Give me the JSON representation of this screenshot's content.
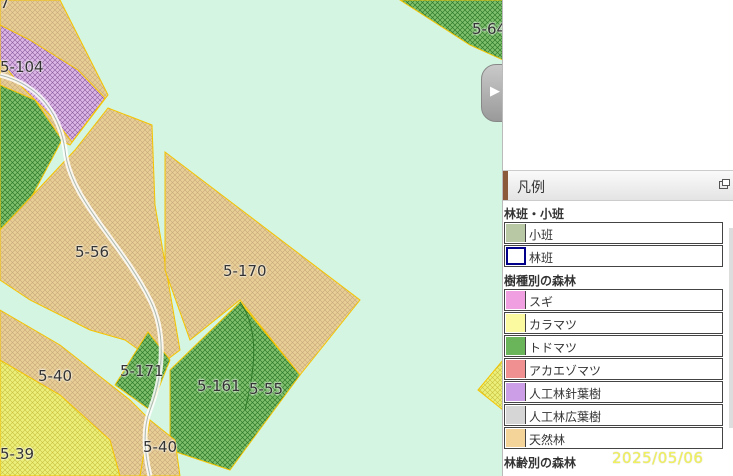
{
  "map": {
    "labels": [
      {
        "name": "stand-5-104",
        "text": "5-104"
      },
      {
        "name": "stand-5-56",
        "text": "5-56"
      },
      {
        "name": "stand-5-170",
        "text": "5-170"
      },
      {
        "name": "stand-5-40-top",
        "text": "5-40"
      },
      {
        "name": "stand-5-171",
        "text": "5-171"
      },
      {
        "name": "stand-5-161",
        "text": "5-161"
      },
      {
        "name": "stand-5-55",
        "text": "5-55"
      },
      {
        "name": "stand-5-39",
        "text": "5-39"
      },
      {
        "name": "stand-5-40-bottom",
        "text": "5-40"
      },
      {
        "name": "stand-5-64",
        "text": "5-64"
      },
      {
        "name": "stand-7-partial",
        "text": "7"
      }
    ]
  },
  "panel": {
    "toggle_icon": "play-arrow-icon",
    "legend_title": "凡例",
    "section_compartment": "林班・小班",
    "compartment_items": [
      {
        "label": "小班",
        "color": "#b8c8a4"
      },
      {
        "label": "林班",
        "color": "#ffffff",
        "border": "#00008b"
      }
    ],
    "section_species": "樹種別の森林",
    "species_items": [
      {
        "label": "スギ",
        "color": "#f0a0e0"
      },
      {
        "label": "カラマツ",
        "color": "#fbfaa0"
      },
      {
        "label": "トドマツ",
        "color": "#6ab45a"
      },
      {
        "label": "アカエゾマツ",
        "color": "#f09090"
      },
      {
        "label": "人工林針葉樹",
        "color": "#cc9ee8"
      },
      {
        "label": "人工林広葉樹",
        "color": "#d6d6d6"
      },
      {
        "label": "天然林",
        "color": "#f5d49a"
      }
    ],
    "section_age": "林齢別の森林"
  },
  "stamp": "2025/05/06"
}
